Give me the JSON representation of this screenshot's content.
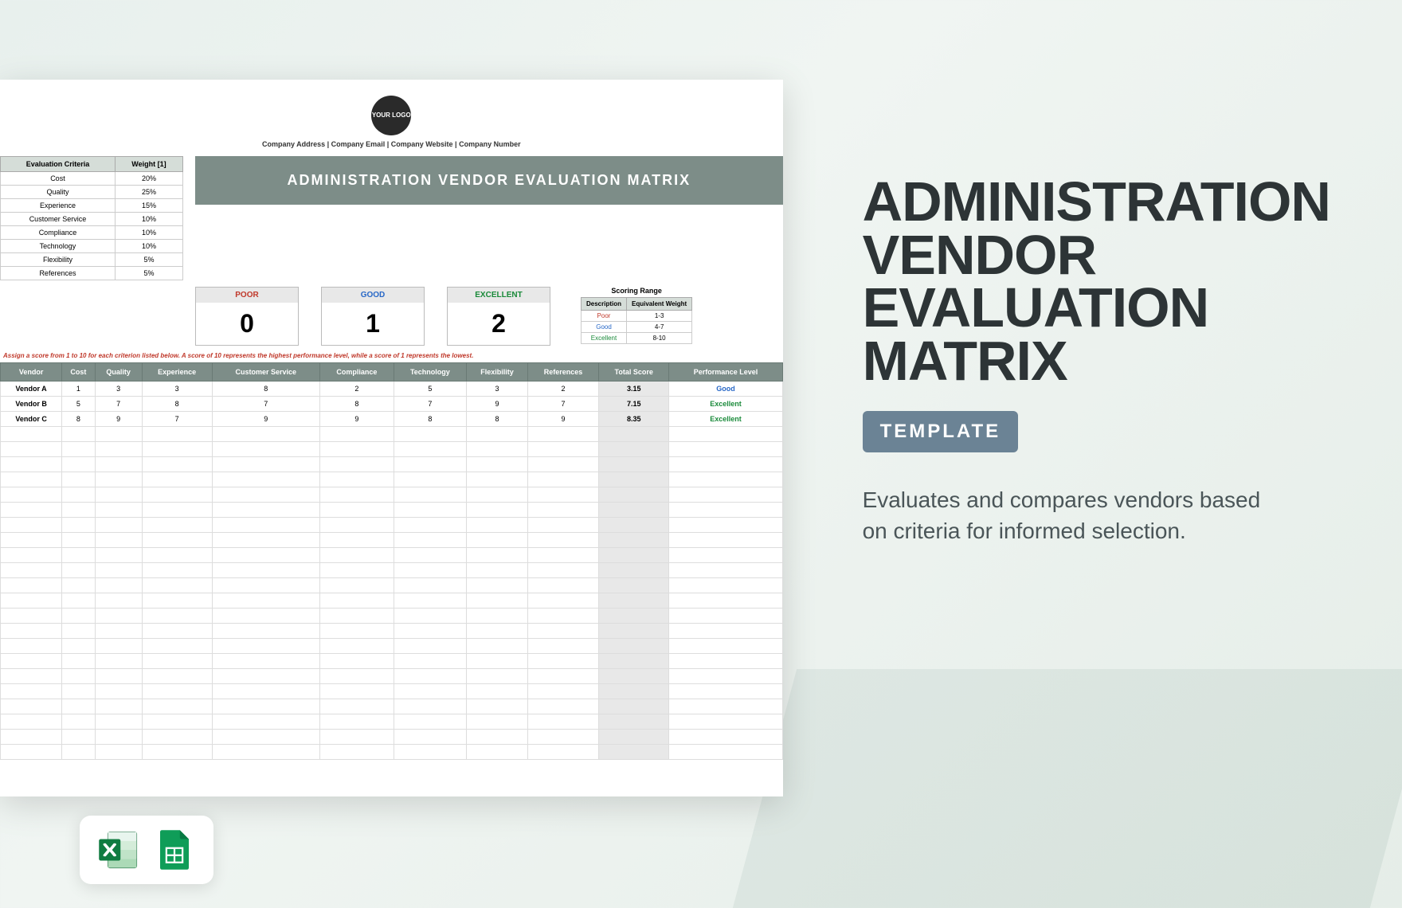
{
  "logo_text": "YOUR LOGO",
  "company_line": "Company Address  |  Company Email  |  Company Website  |  Company Number",
  "banner_title": "ADMINISTRATION VENDOR EVALUATION MATRIX",
  "criteria_headers": {
    "col1": "Evaluation Criteria",
    "col2": "Weight [1]"
  },
  "criteria": [
    {
      "name": "Cost",
      "weight": "20%"
    },
    {
      "name": "Quality",
      "weight": "25%"
    },
    {
      "name": "Experience",
      "weight": "15%"
    },
    {
      "name": "Customer Service",
      "weight": "10%"
    },
    {
      "name": "Compliance",
      "weight": "10%"
    },
    {
      "name": "Technology",
      "weight": "10%"
    },
    {
      "name": "Flexibility",
      "weight": "5%"
    },
    {
      "name": "References",
      "weight": "5%"
    }
  ],
  "score_cards": {
    "poor": {
      "label": "POOR",
      "value": "0"
    },
    "good": {
      "label": "GOOD",
      "value": "1"
    },
    "excellent": {
      "label": "EXCELLENT",
      "value": "2"
    }
  },
  "scoring_range": {
    "title": "Scoring Range",
    "headers": {
      "desc": "Description",
      "eq": "Equivalent Weight"
    },
    "rows": [
      {
        "desc": "Poor",
        "range": "1-3",
        "cls": "poor"
      },
      {
        "desc": "Good",
        "range": "4-7",
        "cls": "good"
      },
      {
        "desc": "Excellent",
        "range": "8-10",
        "cls": "exc"
      }
    ]
  },
  "instruction_text": "Assign a score from 1 to 10 for each criterion listed below. A score of 10 represents the highest performance level, while a score of 1 represents the lowest.",
  "main_headers": [
    "Vendor",
    "Cost",
    "Quality",
    "Experience",
    "Customer Service",
    "Compliance",
    "Technology",
    "Flexibility",
    "References",
    "Total Score",
    "Performance Level"
  ],
  "vendors": [
    {
      "name": "Vendor A",
      "scores": [
        "1",
        "3",
        "3",
        "8",
        "2",
        "5",
        "3",
        "2"
      ],
      "total": "3.15",
      "perf": "Good",
      "perf_cls": "perf-good"
    },
    {
      "name": "Vendor B",
      "scores": [
        "5",
        "7",
        "8",
        "7",
        "8",
        "7",
        "9",
        "7"
      ],
      "total": "7.15",
      "perf": "Excellent",
      "perf_cls": "perf-exc"
    },
    {
      "name": "Vendor C",
      "scores": [
        "8",
        "9",
        "7",
        "9",
        "9",
        "8",
        "8",
        "9"
      ],
      "total": "8.35",
      "perf": "Excellent",
      "perf_cls": "perf-exc"
    }
  ],
  "empty_rows": 22,
  "right": {
    "title_lines": [
      "ADMINISTRATION",
      "VENDOR",
      "EVALUATION",
      "MATRIX"
    ],
    "badge": "TEMPLATE",
    "description": "Evaluates and compares vendors based on criteria for informed selection."
  },
  "chart_data": {
    "type": "table",
    "title": "Administration Vendor Evaluation Matrix",
    "criteria_weights": {
      "Cost": 0.2,
      "Quality": 0.25,
      "Experience": 0.15,
      "Customer Service": 0.1,
      "Compliance": 0.1,
      "Technology": 0.1,
      "Flexibility": 0.05,
      "References": 0.05
    },
    "scoring_legend": {
      "Poor": "1-3",
      "Good": "4-7",
      "Excellent": "8-10"
    },
    "columns": [
      "Vendor",
      "Cost",
      "Quality",
      "Experience",
      "Customer Service",
      "Compliance",
      "Technology",
      "Flexibility",
      "References",
      "Total Score",
      "Performance Level"
    ],
    "rows": [
      [
        "Vendor A",
        1,
        3,
        3,
        8,
        2,
        5,
        3,
        2,
        3.15,
        "Good"
      ],
      [
        "Vendor B",
        5,
        7,
        8,
        7,
        8,
        7,
        9,
        7,
        7.15,
        "Excellent"
      ],
      [
        "Vendor C",
        8,
        9,
        7,
        9,
        9,
        8,
        8,
        9,
        8.35,
        "Excellent"
      ]
    ]
  }
}
